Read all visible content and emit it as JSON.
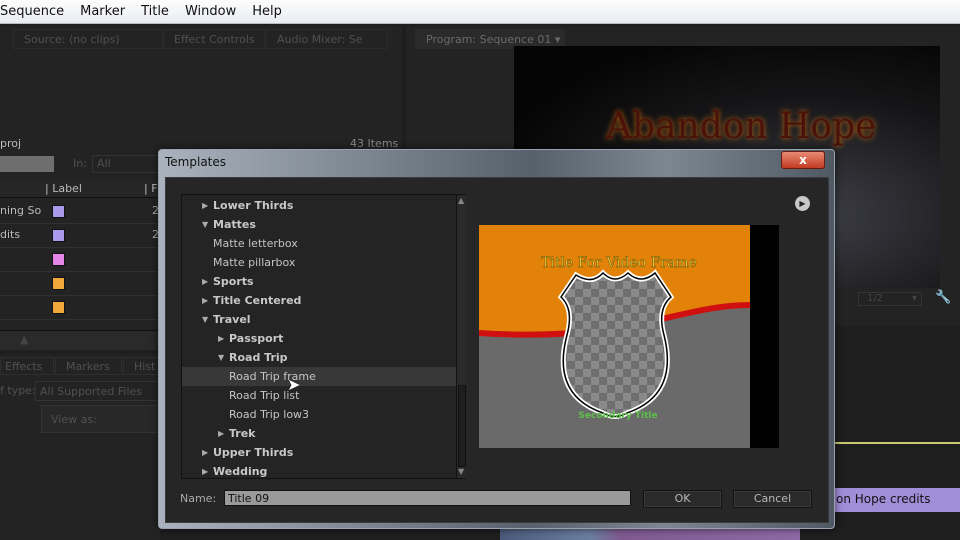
{
  "menu": [
    "Sequence",
    "Marker",
    "Title",
    "Window",
    "Help"
  ],
  "tabs": {
    "source": "Source: (no clips)",
    "effect_controls": "Effect Controls",
    "audio_mixer": "Audio Mixer: Se",
    "program": "Program: Sequence 01"
  },
  "project": {
    "name": "proj",
    "item_count": "43 Items",
    "in_label": "In:",
    "in_value": "All",
    "column_label": "Label",
    "column_f": "F",
    "rows": [
      {
        "name": "ning So",
        "color": "#a89ae8",
        "val": "2"
      },
      {
        "name": "dits",
        "color": "#a89ae8",
        "val": "2"
      },
      {
        "name": "",
        "color": "#e486e8",
        "val": ""
      },
      {
        "name": "",
        "color": "#f1a83a",
        "val": ""
      },
      {
        "name": "",
        "color": "#f1a83a",
        "val": ""
      }
    ]
  },
  "browser": {
    "tabs": [
      "Effects",
      "Markers",
      "Hist"
    ],
    "type_label": "f type:",
    "type_value": "All Supported Files",
    "view_as": "View as:"
  },
  "program": {
    "title_text": "Abandon Hope",
    "zoom": "1/2"
  },
  "timeline": {
    "clip": "on Hope credits"
  },
  "dialog": {
    "title": "Templates",
    "close": "x",
    "tree": [
      {
        "label": "Lower Thirds",
        "type": "folder",
        "expanded": false,
        "level": 0
      },
      {
        "label": "Mattes",
        "type": "folder",
        "expanded": true,
        "level": 0
      },
      {
        "label": "Matte letterbox",
        "type": "item",
        "level": 1
      },
      {
        "label": "Matte pillarbox",
        "type": "item",
        "level": 1
      },
      {
        "label": "Sports",
        "type": "folder",
        "expanded": false,
        "level": 0
      },
      {
        "label": "Title Centered",
        "type": "folder",
        "expanded": false,
        "level": 0
      },
      {
        "label": "Travel",
        "type": "folder",
        "expanded": true,
        "level": 0
      },
      {
        "label": "Passport",
        "type": "folder",
        "expanded": false,
        "level": 1
      },
      {
        "label": "Road Trip",
        "type": "folder",
        "expanded": true,
        "level": 1
      },
      {
        "label": "Road Trip frame",
        "type": "item",
        "level": 2,
        "selected": true
      },
      {
        "label": "Road Trip list",
        "type": "item",
        "level": 2
      },
      {
        "label": "Road Trip low3",
        "type": "item",
        "level": 2
      },
      {
        "label": "Trek",
        "type": "folder",
        "expanded": false,
        "level": 1
      },
      {
        "label": "Upper Thirds",
        "type": "folder",
        "expanded": false,
        "level": 0
      },
      {
        "label": "Wedding",
        "type": "folder",
        "expanded": false,
        "level": 0
      }
    ],
    "preview": {
      "title": "Title For Video Frame",
      "subtitle": "Secondary Title"
    },
    "name_label": "Name:",
    "name_value": "Title 09",
    "ok": "OK",
    "cancel": "Cancel"
  }
}
